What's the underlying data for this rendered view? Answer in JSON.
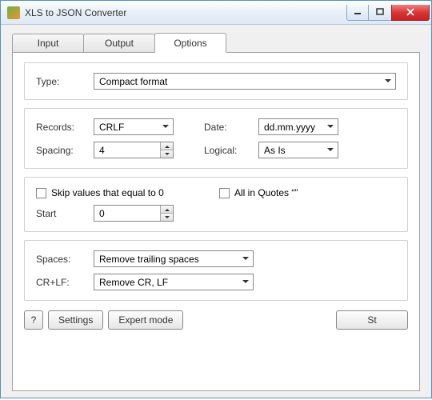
{
  "window": {
    "title": "XLS to JSON Converter"
  },
  "tabs": {
    "input": "Input",
    "output": "Output",
    "options": "Options"
  },
  "options": {
    "type_label": "Type:",
    "type_value": "Compact format",
    "records_label": "Records:",
    "records_value": "CRLF",
    "spacing_label": "Spacing:",
    "spacing_value": "4",
    "date_label": "Date:",
    "date_value": "dd.mm.yyyy",
    "logical_label": "Logical:",
    "logical_value": "As Is",
    "skip_zero_label": "Skip values that equal to 0",
    "all_quotes_label": "All in Quotes “”",
    "start_label": "Start",
    "start_value": "0",
    "spaces_label": "Spaces:",
    "spaces_value": "Remove trailing spaces",
    "crlf_label": "CR+LF:",
    "crlf_value": "Remove CR, LF"
  },
  "footer": {
    "help": "?",
    "settings": "Settings",
    "expert": "Expert mode",
    "start": "St"
  }
}
